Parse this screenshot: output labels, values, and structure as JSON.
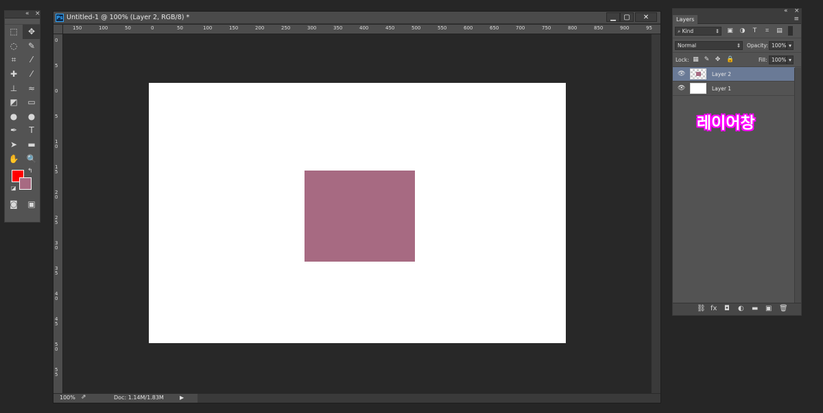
{
  "tools_panel": {
    "collapse_glyph": "«",
    "close_glyph": "×",
    "tools": [
      {
        "name": "rect-marquee-icon",
        "glyph": "⬚"
      },
      {
        "name": "move-icon",
        "glyph": "✥",
        "active": true
      },
      {
        "name": "lasso-icon",
        "glyph": "◌"
      },
      {
        "name": "quick-select-icon",
        "glyph": "✎"
      },
      {
        "name": "crop-icon",
        "glyph": "⌗"
      },
      {
        "name": "eyedropper-icon",
        "glyph": "⁄"
      },
      {
        "name": "healing-brush-icon",
        "glyph": "✚"
      },
      {
        "name": "brush-icon",
        "glyph": "⁄"
      },
      {
        "name": "clone-stamp-icon",
        "glyph": "⊥"
      },
      {
        "name": "history-brush-icon",
        "glyph": "≈"
      },
      {
        "name": "eraser-icon",
        "glyph": "◩"
      },
      {
        "name": "gradient-icon",
        "glyph": "▭"
      },
      {
        "name": "blur-icon",
        "glyph": "●"
      },
      {
        "name": "dodge-icon",
        "glyph": "●"
      },
      {
        "name": "pen-icon",
        "glyph": "✒"
      },
      {
        "name": "type-icon",
        "glyph": "T"
      },
      {
        "name": "path-select-icon",
        "glyph": "➤"
      },
      {
        "name": "rectangle-shape-icon",
        "glyph": "▬"
      },
      {
        "name": "hand-icon",
        "glyph": "✋"
      },
      {
        "name": "zoom-icon",
        "glyph": "🔍"
      }
    ],
    "foreground_color": "#ff0000",
    "background_color": "#a76a82",
    "swap_glyph": "↰",
    "default_glyph": "◪",
    "quick_mask_glyph": "◙",
    "screen_mode_glyph": "▣"
  },
  "document": {
    "title": "Untitled-1 @ 100% (Layer 2, RGB/8) *",
    "app_icon": "Ps",
    "minimize_glyph": "▁",
    "maximize_glyph": "▢",
    "close_glyph": "✕",
    "ruler_h_labels": [
      "150",
      "100",
      "50",
      "0",
      "50",
      "100",
      "150",
      "200",
      "250",
      "300",
      "350",
      "400",
      "450",
      "500",
      "550",
      "600",
      "650",
      "700",
      "750",
      "800",
      "850",
      "900",
      "95"
    ],
    "ruler_v_labels": [
      "0",
      "5",
      "0",
      "5",
      "1 0",
      "1 5",
      "2 0",
      "2 5",
      "3 0",
      "3 5",
      "4 0",
      "4 5",
      "5 0",
      "5 5"
    ],
    "canvas_color": "#ffffff",
    "shape_color": "#a76a82",
    "zoom": "100%",
    "share_glyph": "⇗",
    "doc_info": "Doc: 1.14M/1.83M",
    "status_arrow": "▶"
  },
  "layers_panel": {
    "collapse_glyph": "«",
    "close_glyph": "×",
    "tab_label": "Layers",
    "menu_glyph": "≡",
    "kind_label": "Kind",
    "blend_mode": "Normal",
    "opacity_label": "Opacity:",
    "opacity_value": "100%",
    "lock_label": "Lock:",
    "fill_label": "Fill:",
    "fill_value": "100%",
    "layers": [
      {
        "name": "Layer 2",
        "selected": true
      },
      {
        "name": "Layer 1",
        "selected": false
      }
    ],
    "eye_glyph": "👁",
    "footer_icons": [
      "⛓",
      "fx",
      "◘",
      "◐",
      "▬",
      "▣",
      "🗑"
    ]
  },
  "annotation": "레이어창"
}
